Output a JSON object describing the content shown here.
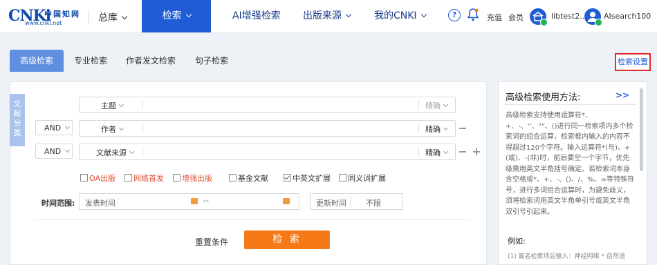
{
  "header": {
    "logo_big": "CNKi",
    "logo_cn": "中国知网",
    "logo_url": "www.cnki.net",
    "library": "总库",
    "nav": [
      {
        "label": "检索"
      },
      {
        "label": "AI增强检索"
      },
      {
        "label": "出版来源"
      },
      {
        "label": "我的CNKI"
      }
    ],
    "help_glyph": "?",
    "recharge": "充值",
    "member": "会员",
    "user1": "libtest2...",
    "user2": "AIsearch100"
  },
  "tabs": [
    "高级检索",
    "专业检索",
    "作者发文检索",
    "句子检索"
  ],
  "settings_label": "检索设置",
  "category_tab": "文献分类",
  "search_rows": [
    {
      "field": "主题",
      "match": "精确"
    },
    {
      "logic": "AND",
      "field": "作者",
      "match": "精确"
    },
    {
      "logic": "AND",
      "field": "文献来源",
      "match": "精确"
    }
  ],
  "checkboxes": [
    {
      "label": "OA出版",
      "checked": false,
      "highlight": true
    },
    {
      "label": "网络首发",
      "checked": false,
      "highlight": true
    },
    {
      "label": "增强出版",
      "checked": false,
      "highlight": true
    },
    {
      "label": "基金文献",
      "checked": false,
      "highlight": false
    },
    {
      "label": "中英文扩展",
      "checked": true,
      "highlight": false
    },
    {
      "label": "同义词扩展",
      "checked": false,
      "highlight": false
    }
  ],
  "time": {
    "label": "时间范围:",
    "publish_placeholder": "发表时间",
    "range_sep": "--",
    "update_label": "更新时间",
    "update_value": "不限"
  },
  "reset_label": "重置条件",
  "search_label": "检 索",
  "help_panel": {
    "title": "高级检索使用方法:",
    "more": ">>",
    "body": "高级检索支持使用运算符*、+、-、''、\"\"、()进行同一检索项内多个检索词的组合运算，检索框内输入的内容不得超过120个字符。输入运算符*(与)、+(或)、-(非)时，前后要空一个字节，优先级需用英文半角括号确定。若检索词本身含空格或*、+、-、()、/、%、=等特殊符号，进行多词组合运算时，为避免歧义，须将检索词用英文半角单引号或英文半角双引号引起来。",
    "example_title": "例如:",
    "example_1": "(1) 篇名检索项后输入：神经网络 * 自然语"
  },
  "colors": {
    "brand": "#1f5cd6",
    "tab_active": "#5f8fe0",
    "search_button": "#f57a17",
    "highlight_red": "#e24b2f",
    "settings_border": "#e02b2b"
  }
}
